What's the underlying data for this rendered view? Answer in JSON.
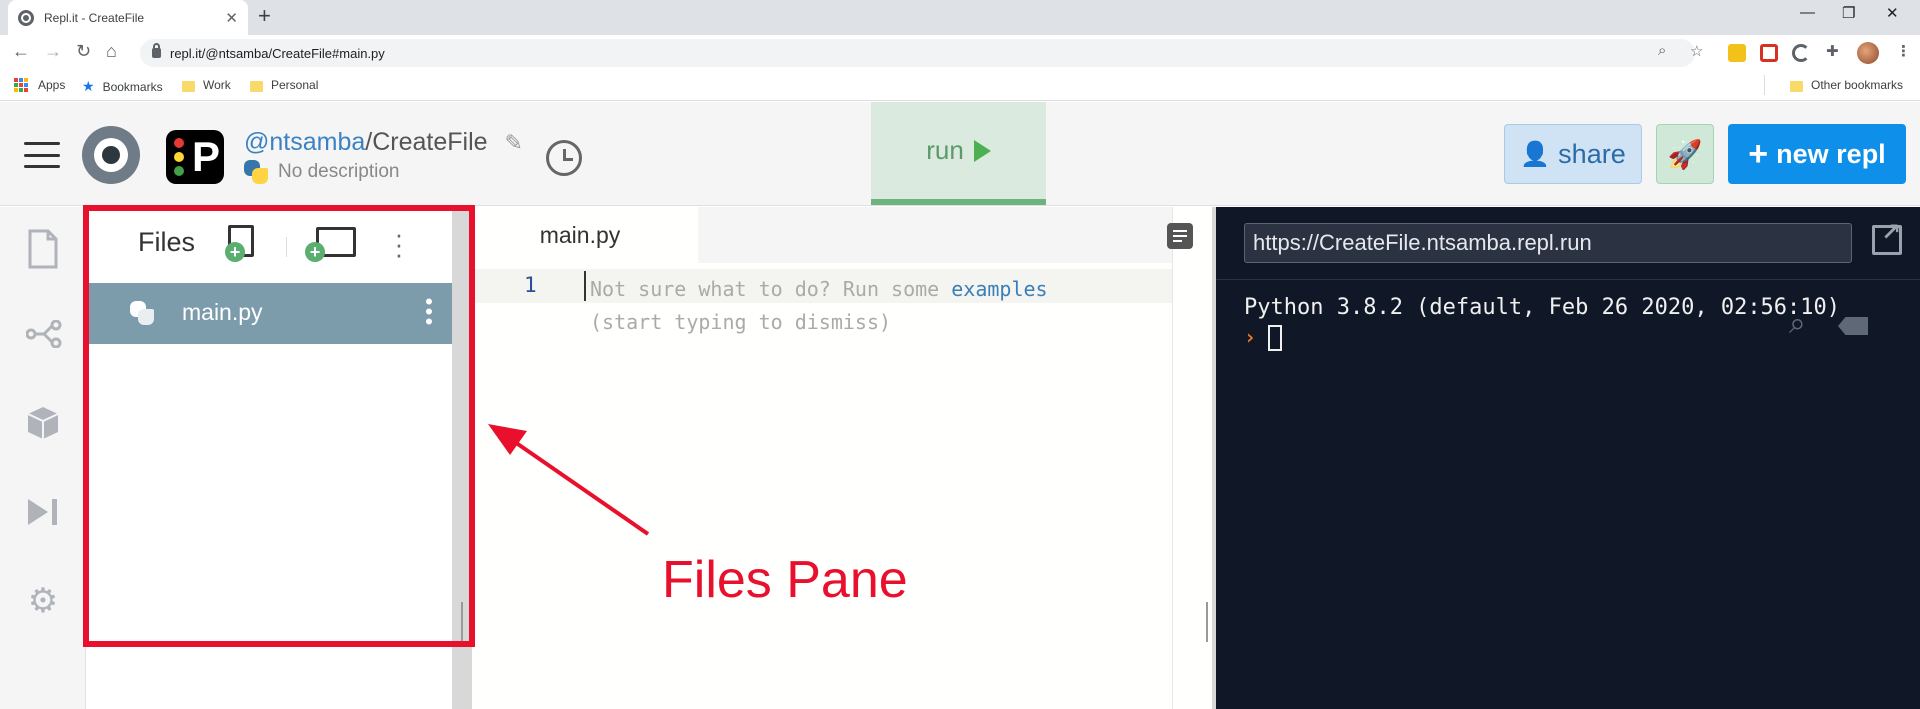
{
  "browser": {
    "tab_title": "Repl.it - CreateFile",
    "tab_close": "✕",
    "new_tab": "+",
    "url": "repl.it/@ntsamba/CreateFile#main.py",
    "bookmarks": {
      "apps": "Apps",
      "items": [
        "Bookmarks",
        "Work",
        "Personal"
      ],
      "other": "Other bookmarks"
    }
  },
  "header": {
    "owner": "@ntsamba",
    "separator": "/",
    "repl_name": "CreateFile",
    "description": "No description",
    "run_label": "run",
    "share_label": "share",
    "new_repl_label": "new repl",
    "lang_logo_letter": "P"
  },
  "files": {
    "title": "Files",
    "items": [
      {
        "name": "main.py",
        "selected": true
      }
    ]
  },
  "editor": {
    "tab": "main.py",
    "line_number": "1",
    "hint_prefix": "Not sure what to do? Run some ",
    "hint_link": "examples",
    "hint_line2": "(start typing to dismiss)"
  },
  "console": {
    "url": "https://CreateFile.ntsamba.repl.run",
    "output": "Python 3.8.2 (default, Feb 26 2020, 02:56:10)",
    "prompt": "›"
  },
  "annotation": {
    "label": "Files Pane",
    "color": "#e8102d"
  },
  "colors": {
    "run_bg": "#dbeadf",
    "share_bg": "#cfe3f5",
    "new_repl_bg": "#0e8fe9",
    "selected_file_bg": "#7c9bab",
    "console_bg": "#101828"
  }
}
